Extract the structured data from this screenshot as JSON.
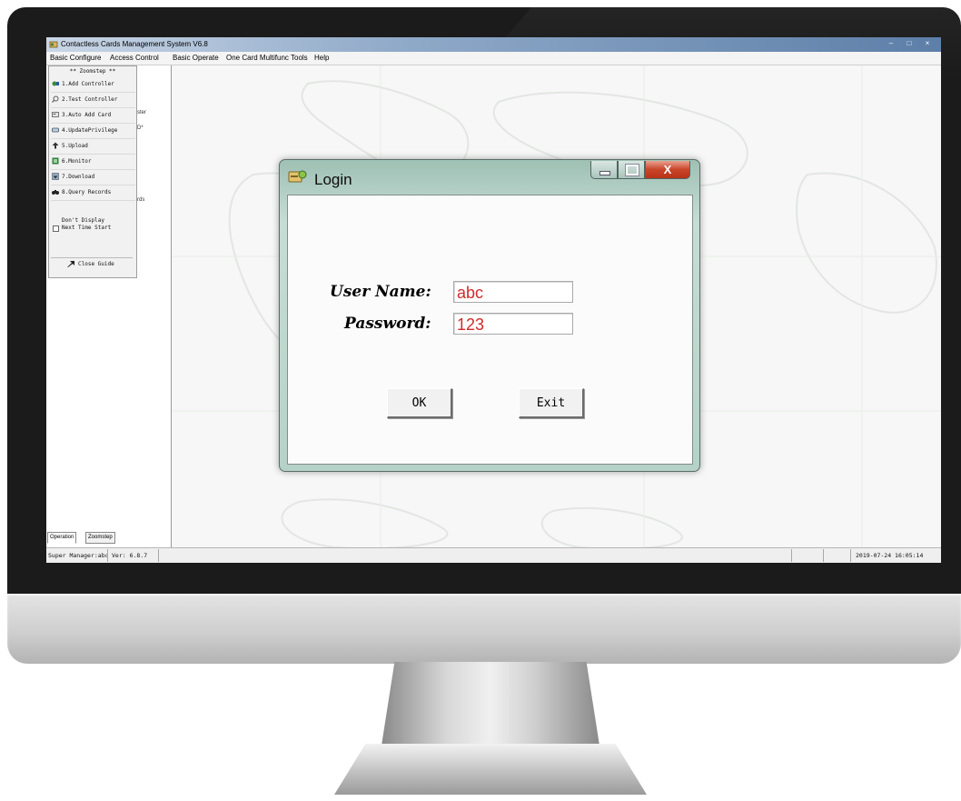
{
  "app": {
    "title": "Contactless Cards Management System  V6.8",
    "window_controls": [
      "–",
      "□",
      "×"
    ]
  },
  "menubar": {
    "items": [
      "Basic Configure",
      "Access Control",
      "Basic Operate",
      "One Card Multifunc",
      "Tools",
      "Help"
    ]
  },
  "nav": {
    "hint_1": "ster",
    "hint_2": "D*",
    "hint_3": "rds"
  },
  "guide": {
    "header": "** Zoomstep **",
    "items": [
      {
        "label": "1.Add Controller",
        "icon": "controller-icon"
      },
      {
        "label": "2.Test Controller",
        "icon": "test-icon"
      },
      {
        "label": "3.Auto Add Card",
        "icon": "card-icon"
      },
      {
        "label": "4.UpdatePrivilege",
        "icon": "privilege-icon"
      },
      {
        "label": "5.Upload",
        "icon": "upload-icon"
      },
      {
        "label": "6.Monitor",
        "icon": "monitor-icon"
      },
      {
        "label": "7.Download",
        "icon": "download-icon"
      },
      {
        "label": "8.Query Records",
        "icon": "binoculars-icon"
      }
    ],
    "checkbox_line1": "Don't Display",
    "checkbox_line2": "Next Time Start",
    "close_label": "Close Guide"
  },
  "nav_tabs": [
    "Operation",
    "Zoomstep"
  ],
  "status": {
    "user": "Super Manager:abc",
    "version": "Ver: 6.8.7",
    "datetime": "2019-07-24 16:05:14"
  },
  "dialog": {
    "title": "Login",
    "username_label": "User Name:",
    "username_value": "abc",
    "password_label": "Password:",
    "password_value": "123",
    "ok_label": "OK",
    "exit_label": "Exit",
    "close_glyph": "X"
  },
  "colors": {
    "input_text": "#d12b2b",
    "dialog_frame": "#b6d2c8",
    "close_button": "#c9452a"
  }
}
